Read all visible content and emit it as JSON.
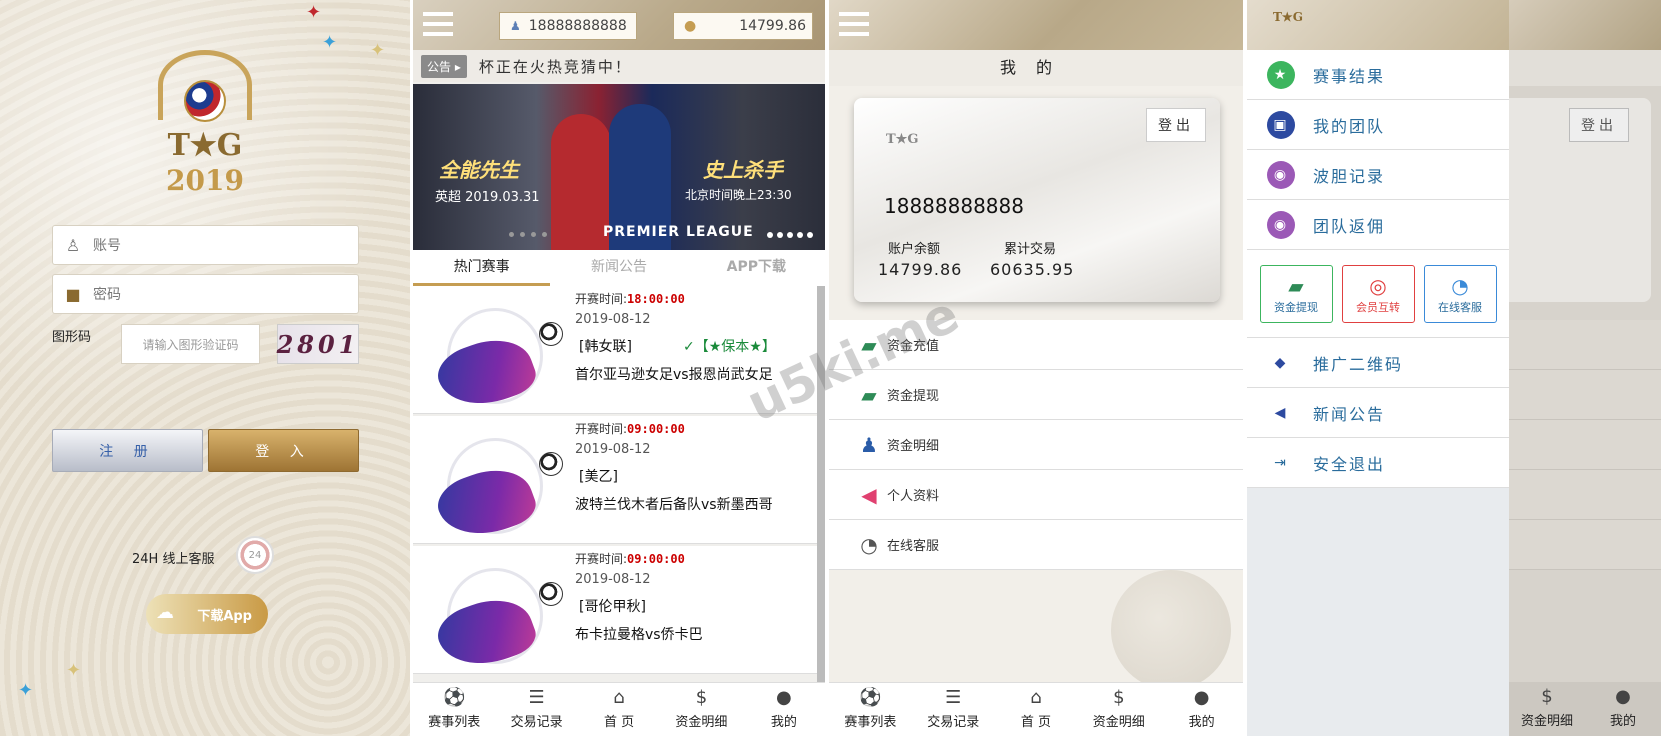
{
  "login": {
    "logo_tg": "T★G",
    "logo_year": "2019",
    "account_placeholder": "账号",
    "password_placeholder": "密码",
    "captcha_label": "图形码",
    "captcha_placeholder": "请输入图形验证码",
    "captcha_text": "2801",
    "register_label": "注 册",
    "login_label": "登 入",
    "service_label": "24H 线上客服",
    "service_icon_text": "24",
    "download_label": "下载App"
  },
  "home": {
    "phone": "18888888888",
    "balance": "14799.86",
    "notice_tag": "公告",
    "notice_text": "杯正在火热竞猜中！",
    "banner": {
      "left_title": "全能先生",
      "left_sub": "英超 2019.03.31",
      "right_title": "史上杀手",
      "right_sub": "北京时间晚上23:30",
      "league": "PREMIER LEAGUE"
    },
    "tabs": [
      "热门赛事",
      "新闻公告",
      "APP下载"
    ],
    "time_prefix": "开赛时间:",
    "matches": [
      {
        "time": "18:00:00",
        "date": "2019-08-12",
        "league": "[韩女联]",
        "tag": "✓【★保本★】",
        "teams": "首尔亚马逊女足vs报恩尚武女足"
      },
      {
        "time": "09:00:00",
        "date": "2019-08-12",
        "league": "[美乙]",
        "tag": "",
        "teams": "波特兰伐木者后备队vs新墨西哥"
      },
      {
        "time": "09:00:00",
        "date": "2019-08-12",
        "league": "[哥伦甲秋]",
        "tag": "",
        "teams": "布卡拉曼格vs侨卡巴"
      }
    ],
    "nav": [
      "赛事列表",
      "交易记录",
      "首 页",
      "资金明细",
      "我的"
    ]
  },
  "profile": {
    "title": "我的",
    "logout_label": "登出",
    "card_logo": "T★G",
    "phone": "18888888888",
    "balance_label": "账户余额",
    "balance": "14799.86",
    "trade_label": "累计交易",
    "trade": "60635.95",
    "menu": [
      "资金充值",
      "资金提现",
      "资金明细",
      "个人资料",
      "在线客服"
    ],
    "nav": [
      "赛事列表",
      "交易记录",
      "首 页",
      "资金明细",
      "我的"
    ]
  },
  "sidemenu": {
    "logo": "T★G",
    "items_top": [
      "赛事结果",
      "我的团队",
      "波胆记录",
      "团队返佣"
    ],
    "buttons": [
      "资金提现",
      "会员互转",
      "在线客服"
    ],
    "items_bottom": [
      "推广二维码",
      "新闻公告",
      "安全退出"
    ],
    "behind_logout": "登出",
    "behind_nav": [
      "资金明细",
      "我的"
    ]
  },
  "watermark": "u5ki.me",
  "colors": {
    "gold": "#c59d52",
    "link_blue": "#2a6c9c",
    "time_red": "#c00000"
  }
}
